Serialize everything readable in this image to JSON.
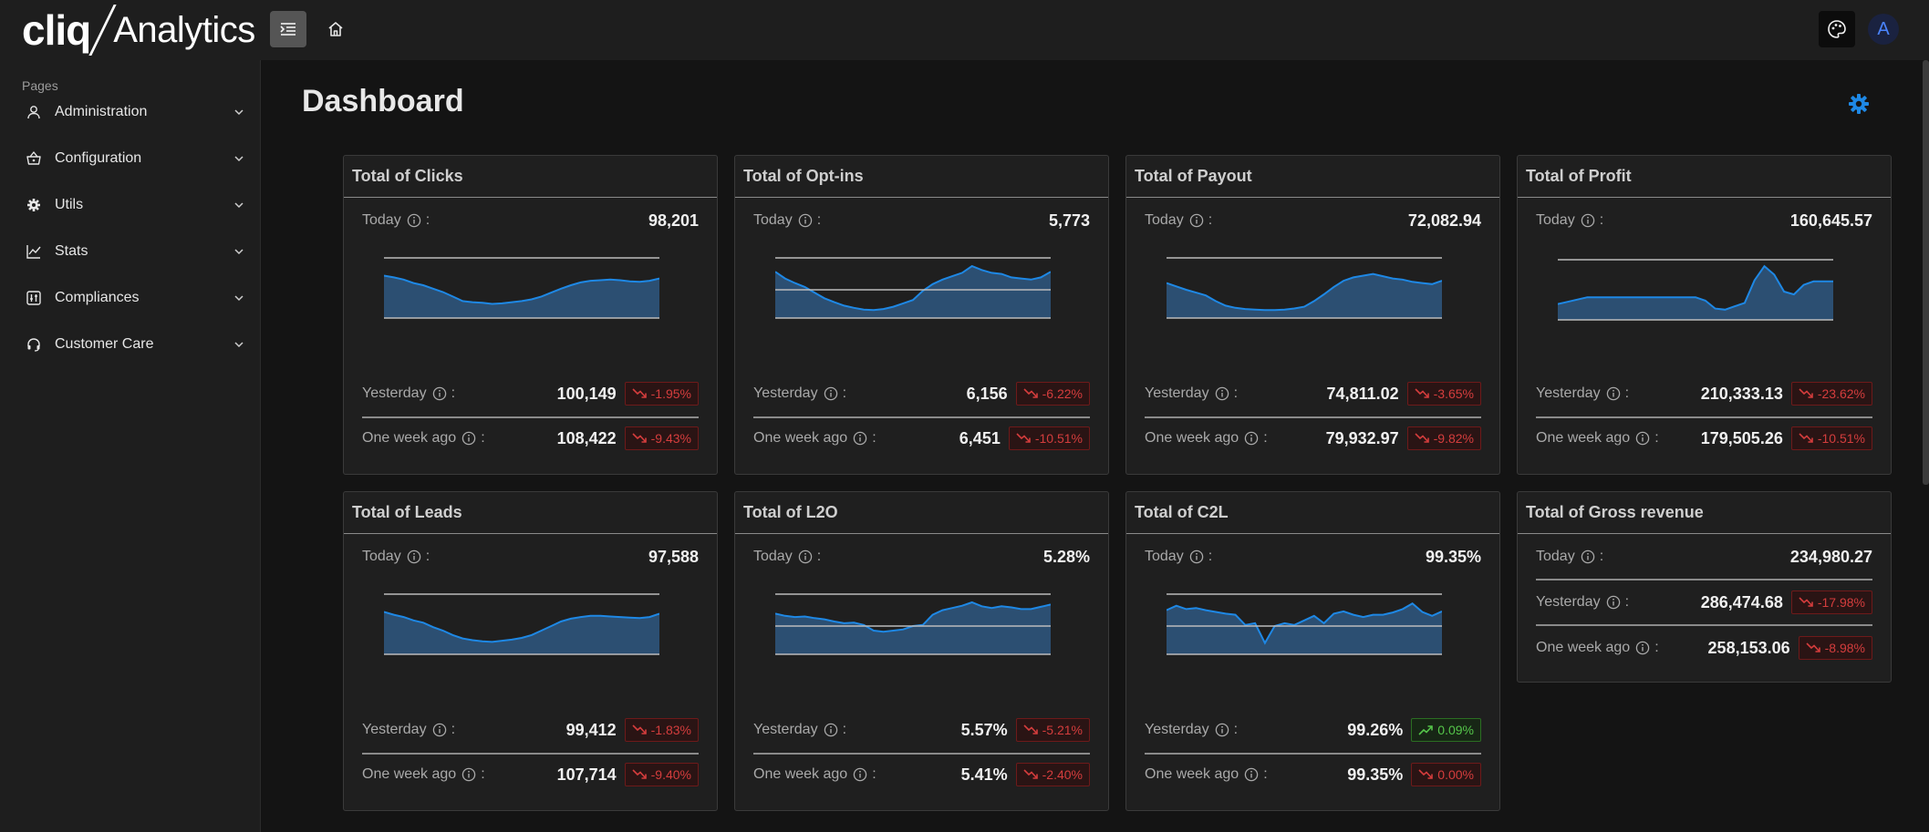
{
  "brand": {
    "bold": "cliq",
    "light": "Analytics"
  },
  "header": {
    "avatar_letter": "A"
  },
  "sidebar": {
    "section_label": "Pages",
    "items": [
      {
        "label": "Administration",
        "icon": "user-icon"
      },
      {
        "label": "Configuration",
        "icon": "basket-icon"
      },
      {
        "label": "Utils",
        "icon": "gear-icon"
      },
      {
        "label": "Stats",
        "icon": "chart-line-icon"
      },
      {
        "label": "Compliances",
        "icon": "adjust-icon"
      },
      {
        "label": "Customer Care",
        "icon": "headset-icon"
      }
    ]
  },
  "page": {
    "title": "Dashboard"
  },
  "labels": {
    "today": "Today",
    "yesterday": "Yesterday",
    "week": "One week ago",
    "colon": ":"
  },
  "colors": {
    "accent": "#1e88e5",
    "down": "#d43d3d",
    "up": "#55c54a"
  },
  "cards": [
    {
      "title": "Total of Clicks",
      "today": "98,201",
      "yesterday": "100,149",
      "yesterday_delta": "-1.95%",
      "yesterday_trend": "down",
      "week": "108,422",
      "week_delta": "-9.43%",
      "week_trend": "down",
      "spark": [
        0.75,
        0.72,
        0.68,
        0.62,
        0.58,
        0.52,
        0.46,
        0.38,
        0.3,
        0.28,
        0.27,
        0.25,
        0.26,
        0.28,
        0.3,
        0.33,
        0.38,
        0.45,
        0.52,
        0.58,
        0.63,
        0.66,
        0.67,
        0.68,
        0.67,
        0.65,
        0.64,
        0.66,
        0.7
      ],
      "spark_ref": null
    },
    {
      "title": "Total of Opt-ins",
      "today": "5,773",
      "yesterday": "6,156",
      "yesterday_delta": "-6.22%",
      "yesterday_trend": "down",
      "week": "6,451",
      "week_delta": "-10.51%",
      "week_trend": "down",
      "spark": [
        0.82,
        0.7,
        0.62,
        0.55,
        0.45,
        0.35,
        0.28,
        0.22,
        0.18,
        0.15,
        0.14,
        0.16,
        0.2,
        0.26,
        0.32,
        0.48,
        0.6,
        0.68,
        0.74,
        0.8,
        0.92,
        0.85,
        0.8,
        0.78,
        0.72,
        0.7,
        0.68,
        0.72,
        0.82
      ],
      "spark_ref": 0.5
    },
    {
      "title": "Total of Payout",
      "today": "72,082.94",
      "yesterday": "74,811.02",
      "yesterday_delta": "-3.65%",
      "yesterday_trend": "down",
      "week": "79,932.97",
      "week_delta": "-9.82%",
      "week_trend": "down",
      "spark": [
        0.62,
        0.56,
        0.5,
        0.45,
        0.4,
        0.3,
        0.22,
        0.18,
        0.16,
        0.15,
        0.14,
        0.14,
        0.15,
        0.17,
        0.2,
        0.3,
        0.42,
        0.55,
        0.66,
        0.72,
        0.75,
        0.78,
        0.74,
        0.7,
        0.68,
        0.64,
        0.62,
        0.6,
        0.66
      ],
      "spark_ref": null
    },
    {
      "title": "Total of Profit",
      "today": "160,645.57",
      "yesterday": "210,333.13",
      "yesterday_delta": "-23.62%",
      "yesterday_trend": "down",
      "week": "179,505.26",
      "week_delta": "-10.51%",
      "week_trend": "down",
      "spark": [
        0.28,
        0.32,
        0.36,
        0.4,
        0.4,
        0.4,
        0.4,
        0.4,
        0.4,
        0.4,
        0.4,
        0.4,
        0.4,
        0.4,
        0.4,
        0.34,
        0.2,
        0.18,
        0.24,
        0.3,
        0.7,
        0.95,
        0.8,
        0.5,
        0.45,
        0.62,
        0.68,
        0.68,
        0.68
      ],
      "spark_ref": null
    },
    {
      "title": "Total of Leads",
      "today": "97,588",
      "yesterday": "99,412",
      "yesterday_delta": "-1.83%",
      "yesterday_trend": "down",
      "week": "107,714",
      "week_delta": "-9.40%",
      "week_trend": "down",
      "spark": [
        0.75,
        0.7,
        0.66,
        0.6,
        0.56,
        0.48,
        0.42,
        0.34,
        0.28,
        0.25,
        0.23,
        0.22,
        0.24,
        0.26,
        0.29,
        0.34,
        0.42,
        0.5,
        0.58,
        0.63,
        0.66,
        0.68,
        0.68,
        0.67,
        0.66,
        0.65,
        0.64,
        0.66,
        0.72
      ],
      "spark_ref": null
    },
    {
      "title": "Total of L2O",
      "today": "5.28%",
      "yesterday": "5.57%",
      "yesterday_delta": "-5.21%",
      "yesterday_trend": "down",
      "week": "5.41%",
      "week_delta": "-2.40%",
      "week_trend": "down",
      "spark": [
        0.72,
        0.68,
        0.66,
        0.67,
        0.64,
        0.62,
        0.58,
        0.55,
        0.56,
        0.52,
        0.42,
        0.4,
        0.42,
        0.44,
        0.5,
        0.52,
        0.7,
        0.78,
        0.82,
        0.86,
        0.92,
        0.85,
        0.82,
        0.85,
        0.83,
        0.8,
        0.8,
        0.84,
        0.88
      ],
      "spark_ref": 0.5
    },
    {
      "title": "Total of C2L",
      "today": "99.35%",
      "yesterday": "99.26%",
      "yesterday_delta": "0.09%",
      "yesterday_trend": "up",
      "week": "99.35%",
      "week_delta": "0.00%",
      "week_trend": "down",
      "spark": [
        0.78,
        0.86,
        0.8,
        0.82,
        0.78,
        0.75,
        0.72,
        0.7,
        0.52,
        0.55,
        0.2,
        0.5,
        0.55,
        0.52,
        0.6,
        0.68,
        0.55,
        0.72,
        0.76,
        0.7,
        0.66,
        0.7,
        0.7,
        0.74,
        0.8,
        0.9,
        0.75,
        0.68,
        0.76
      ],
      "spark_ref": 0.5
    },
    {
      "title": "Total of Gross revenue",
      "today": "234,980.27",
      "yesterday": "286,474.68",
      "yesterday_delta": "-17.98%",
      "yesterday_trend": "down",
      "week": "258,153.06",
      "week_delta": "-8.98%",
      "week_trend": "down",
      "spark": null,
      "spark_ref": null
    }
  ]
}
